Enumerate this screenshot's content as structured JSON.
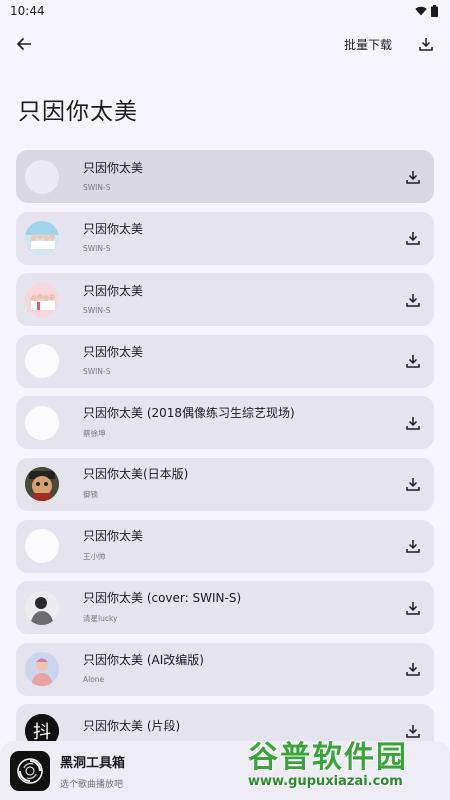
{
  "status": {
    "time": "10:44"
  },
  "toolbar": {
    "batch_download_label": "批量下载"
  },
  "page": {
    "title": "只因你太美"
  },
  "songs": [
    {
      "title": "只因你太美",
      "artist": "SWIN-S",
      "cover": "blank"
    },
    {
      "title": "只因你太美",
      "artist": "SWIN-S",
      "cover": "group-photo-blue"
    },
    {
      "title": "只因你太美",
      "artist": "SWIN-S",
      "cover": "group-photo-pink"
    },
    {
      "title": "只因你太美",
      "artist": "SWIN-S",
      "cover": "blank"
    },
    {
      "title": "只因你太美 (2018偶像练习生综艺现场)",
      "artist": "蔡徐坤",
      "cover": "blank"
    },
    {
      "title": "只因你太美(日本版)",
      "artist": "御锁",
      "cover": "cartoon-avatar"
    },
    {
      "title": "只因你太美",
      "artist": "王小帅",
      "cover": "blank"
    },
    {
      "title": "只因你太美 (cover: SWIN-S)",
      "artist": "清星lucky",
      "cover": "person-gray"
    },
    {
      "title": "只因你太美 (AI改编版)",
      "artist": "Alone",
      "cover": "person-pink"
    },
    {
      "title": "只因你太美 (片段)",
      "artist": "",
      "cover": "tiktok-logo"
    }
  ],
  "player": {
    "title": "黑洞工具箱",
    "subtitle": "选个歌曲播放吧"
  },
  "watermark": {
    "main": "谷普软件园",
    "url": "www.gupuxiazai.com"
  },
  "colors": {
    "card": "#e4e3ee",
    "selected_card": "#d9d8e3",
    "background": "#f6f5fc"
  }
}
